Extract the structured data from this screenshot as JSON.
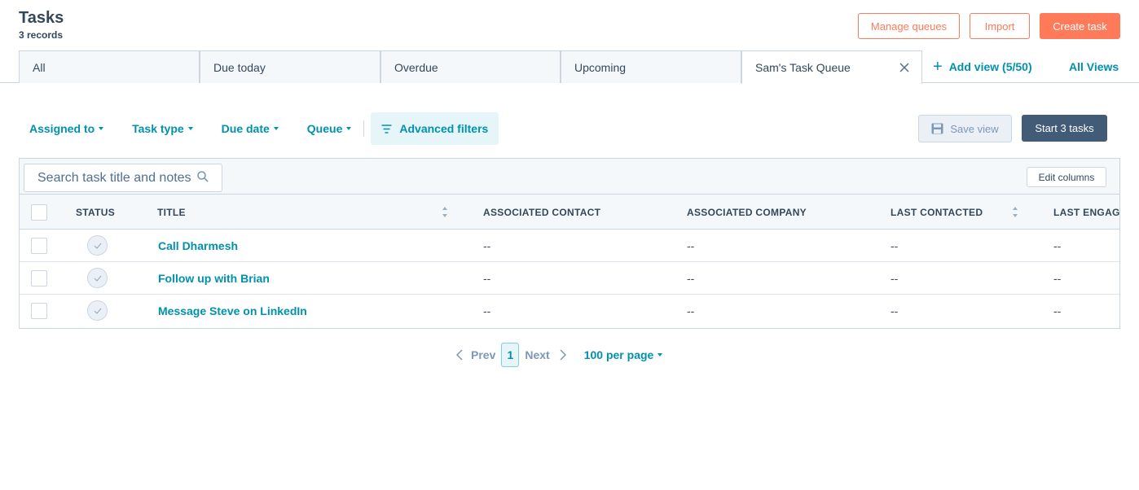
{
  "header": {
    "title": "Tasks",
    "record_count": "3 records"
  },
  "actions": {
    "manage_queues": "Manage queues",
    "import": "Import",
    "create_task": "Create task"
  },
  "tabs": [
    {
      "label": "All"
    },
    {
      "label": "Due today"
    },
    {
      "label": "Overdue"
    },
    {
      "label": "Upcoming"
    },
    {
      "label": "Sam's Task Queue",
      "active": true
    }
  ],
  "add_view": "Add view (5/50)",
  "all_views": "All Views",
  "filters": {
    "assigned_to": "Assigned to",
    "task_type": "Task type",
    "due_date": "Due date",
    "queue": "Queue",
    "advanced": "Advanced filters"
  },
  "save_view": "Save view",
  "start_tasks": "Start 3 tasks",
  "search": {
    "placeholder": "Search task title and notes"
  },
  "edit_columns": "Edit columns",
  "columns": {
    "status": "STATUS",
    "title": "TITLE",
    "associated_contact": "ASSOCIATED CONTACT",
    "associated_company": "ASSOCIATED COMPANY",
    "last_contacted": "LAST CONTACTED",
    "last_engagement": "LAST ENGAGEMENT"
  },
  "rows": [
    {
      "title": "Call Dharmesh",
      "contact": "--",
      "company": "--",
      "last_contacted": "--",
      "last_engagement": "--"
    },
    {
      "title": "Follow up with Brian",
      "contact": "--",
      "company": "--",
      "last_contacted": "--",
      "last_engagement": "--"
    },
    {
      "title": "Message Steve on LinkedIn",
      "contact": "--",
      "company": "--",
      "last_contacted": "--",
      "last_engagement": "--"
    }
  ],
  "pagination": {
    "prev": "Prev",
    "current_page": "1",
    "next": "Next",
    "per_page": "100 per page"
  },
  "colors": {
    "accent_orange": "#ff7a59",
    "link_teal": "#0091ae",
    "dark_slate": "#425b76",
    "text": "#33475b",
    "border": "#cbd6e2"
  }
}
